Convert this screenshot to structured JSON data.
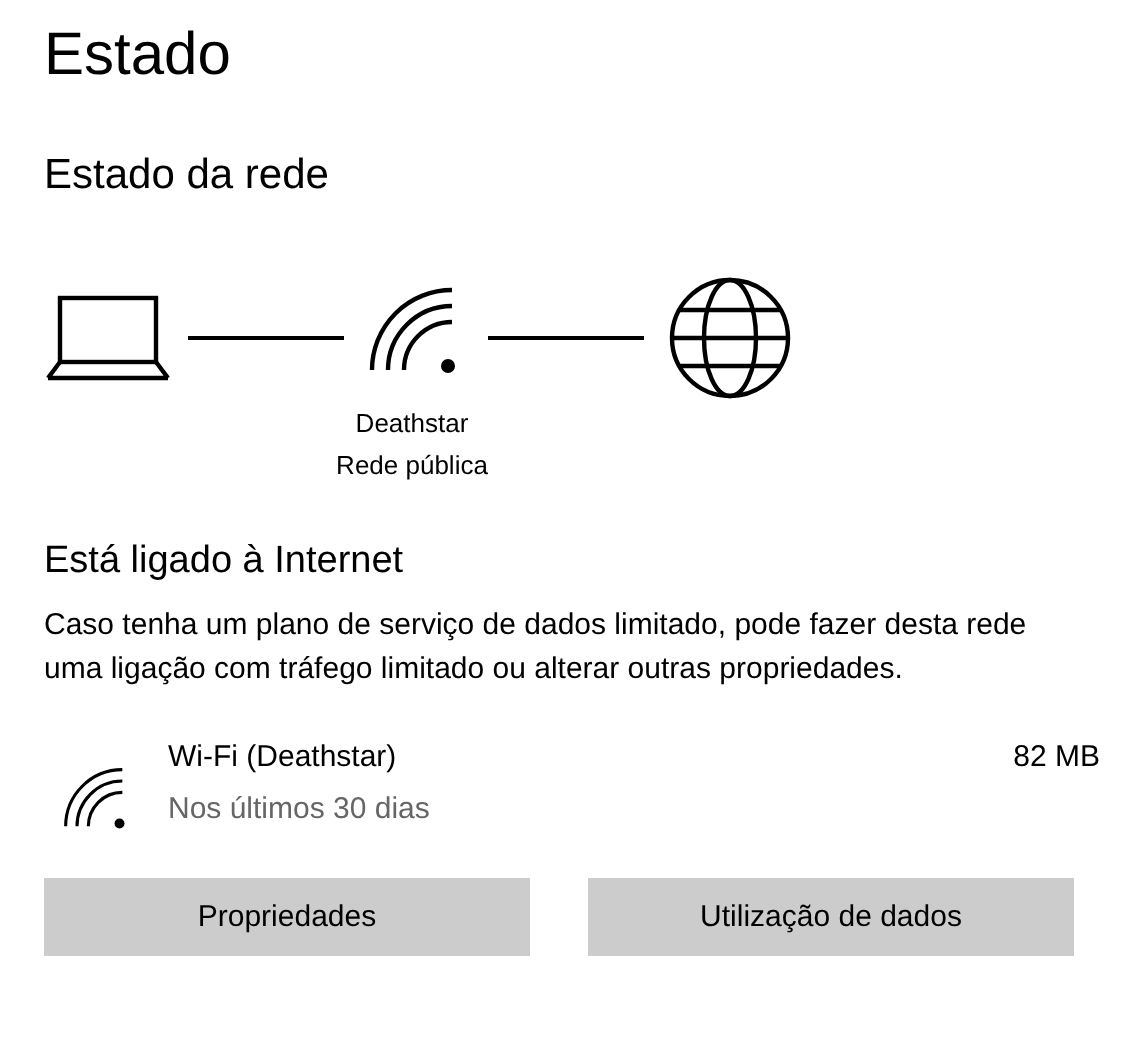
{
  "title": "Estado",
  "network_status": {
    "heading": "Estado da rede",
    "network_name": "Deathstar",
    "network_type": "Rede pública"
  },
  "connection": {
    "heading": "Está ligado à Internet",
    "description": "Caso tenha um plano de serviço de dados limitado, pode fazer desta rede uma ligação com tráfego limitado ou alterar outras propriedades."
  },
  "usage": {
    "name": "Wi-Fi (Deathstar)",
    "period": "Nos últimos 30 dias",
    "amount": "82 MB"
  },
  "buttons": [
    "Propriedades",
    "Utilização de dados"
  ]
}
